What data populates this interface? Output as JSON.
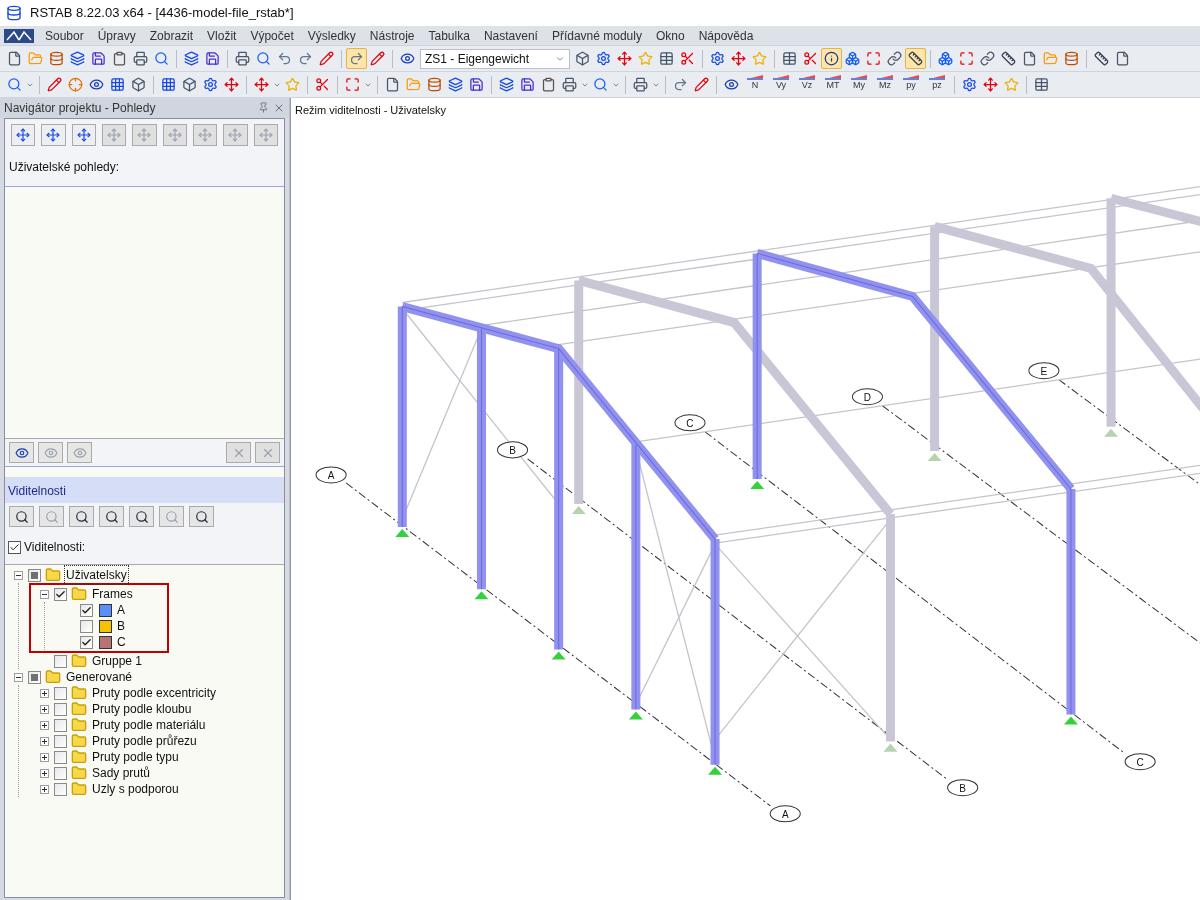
{
  "window": {
    "title": "RSTAB 8.22.03 x64 - [4436-model-file_rstab*]"
  },
  "menu": [
    "Soubor",
    "Úpravy",
    "Zobrazit",
    "Vložit",
    "Výpočet",
    "Výsledky",
    "Nástroje",
    "Tabulka",
    "Nastavení",
    "Přídavné moduly",
    "Okno",
    "Nápověda"
  ],
  "toolbars": [
    [
      [
        {
          "kind": "button",
          "selected": false
        },
        {
          "kind": "button",
          "selected": false
        },
        {
          "kind": "button",
          "selected": false
        },
        {
          "kind": "button",
          "selected": false
        },
        {
          "kind": "button",
          "selected": false
        },
        {
          "kind": "button",
          "selected": false
        },
        {
          "kind": "button",
          "selected": false
        },
        {
          "kind": "button",
          "selected": false
        }
      ],
      [
        {
          "kind": "button",
          "selected": false
        },
        {
          "kind": "button",
          "selected": false
        }
      ],
      [
        {
          "kind": "button",
          "selected": false
        },
        {
          "kind": "button",
          "selected": false
        },
        {
          "kind": "button",
          "selected": false
        },
        {
          "kind": "button",
          "selected": false
        },
        {
          "kind": "button",
          "selected": false
        }
      ],
      [
        {
          "kind": "button",
          "selected": true
        },
        {
          "kind": "button",
          "selected": false
        }
      ],
      [
        {
          "kind": "button",
          "selected": false
        },
        {
          "kind": "combo",
          "value": "ZS1 - Eigengewicht"
        },
        {
          "kind": "button",
          "selected": false
        },
        {
          "kind": "button",
          "selected": false
        },
        {
          "kind": "button",
          "selected": false
        },
        {
          "kind": "button",
          "selected": false
        },
        {
          "kind": "button",
          "selected": false
        },
        {
          "kind": "button",
          "selected": false
        }
      ],
      [
        {
          "kind": "button",
          "selected": false
        },
        {
          "kind": "button",
          "selected": false
        },
        {
          "kind": "button",
          "selected": false
        }
      ],
      [
        {
          "kind": "button",
          "selected": false
        },
        {
          "kind": "button",
          "selected": false
        },
        {
          "kind": "button",
          "selected": true
        },
        {
          "kind": "button",
          "selected": false
        },
        {
          "kind": "button",
          "selected": false
        },
        {
          "kind": "button",
          "selected": false
        },
        {
          "kind": "button",
          "selected": true
        }
      ],
      [
        {
          "kind": "button",
          "selected": false
        },
        {
          "kind": "button",
          "selected": false
        },
        {
          "kind": "button",
          "selected": false
        },
        {
          "kind": "button",
          "selected": false
        },
        {
          "kind": "button",
          "selected": false
        },
        {
          "kind": "button",
          "selected": false
        },
        {
          "kind": "button",
          "selected": false
        }
      ],
      [
        {
          "kind": "button",
          "selected": false
        },
        {
          "kind": "button",
          "selected": false
        }
      ]
    ],
    [
      [
        {
          "kind": "dropdown",
          "selected": false
        }
      ],
      [
        {
          "kind": "button",
          "selected": false
        },
        {
          "kind": "button",
          "selected": false
        },
        {
          "kind": "button",
          "selected": false
        },
        {
          "kind": "button",
          "selected": false
        },
        {
          "kind": "button",
          "selected": false
        }
      ],
      [
        {
          "kind": "button",
          "selected": false
        },
        {
          "kind": "button",
          "selected": false
        },
        {
          "kind": "button",
          "selected": false
        },
        {
          "kind": "button",
          "selected": false
        }
      ],
      [
        {
          "kind": "dropdown",
          "selected": false
        },
        {
          "kind": "button",
          "selected": false
        }
      ],
      [
        {
          "kind": "button",
          "selected": false
        }
      ],
      [
        {
          "kind": "dropdown",
          "selected": false
        }
      ],
      [
        {
          "kind": "button",
          "selected": false
        },
        {
          "kind": "button",
          "selected": false
        },
        {
          "kind": "button",
          "selected": false
        },
        {
          "kind": "button",
          "selected": false
        },
        {
          "kind": "button",
          "selected": false
        }
      ],
      [
        {
          "kind": "button",
          "selected": false
        },
        {
          "kind": "button",
          "selected": false
        },
        {
          "kind": "button",
          "selected": false
        },
        {
          "kind": "dropdown",
          "selected": false
        },
        {
          "kind": "dropdown",
          "selected": false
        }
      ],
      [
        {
          "kind": "dropdown",
          "selected": false
        }
      ],
      [
        {
          "kind": "button",
          "selected": false
        },
        {
          "kind": "button",
          "selected": false
        }
      ],
      [
        {
          "kind": "button",
          "selected": false
        },
        {
          "kind": "labeled",
          "label": "N",
          "selected": false
        },
        {
          "kind": "labeled",
          "label": "Vy",
          "selected": false
        },
        {
          "kind": "labeled",
          "label": "Vz",
          "selected": false
        },
        {
          "kind": "labeled",
          "label": "MT",
          "selected": false
        },
        {
          "kind": "labeled",
          "label": "My",
          "selected": false
        },
        {
          "kind": "labeled",
          "label": "Mz",
          "selected": false
        },
        {
          "kind": "labeled",
          "label": "py",
          "selected": false
        },
        {
          "kind": "labeled",
          "label": "pz",
          "selected": false
        }
      ],
      [
        {
          "kind": "button",
          "selected": false
        },
        {
          "kind": "button",
          "selected": false
        },
        {
          "kind": "button",
          "selected": false
        }
      ],
      [
        {
          "kind": "button",
          "selected": false
        }
      ]
    ]
  ],
  "navigator": {
    "title": "Navigátor projektu - Pohledy",
    "views_label": "Uživatelské pohledy:",
    "visibility": {
      "title": "Viditelnosti",
      "checkbox_label": "Viditelnosti:",
      "checked": true
    },
    "tree": [
      {
        "label": "Uživatelsky",
        "expanded": true,
        "checked": false,
        "indeterminate": true,
        "selected": true,
        "children": [
          {
            "label": "Frames",
            "expanded": true,
            "checked": true,
            "selected": false,
            "highlight": true,
            "children": [
              {
                "label": "A",
                "checked": true,
                "selected": false,
                "color": "#5b8ff9"
              },
              {
                "label": "B",
                "checked": false,
                "indeterminate": false,
                "selected": false,
                "color": "#f5c400"
              },
              {
                "label": "C",
                "checked": true,
                "selected": false,
                "color": "#b87474"
              }
            ]
          },
          {
            "label": "Gruppe 1",
            "checked": false,
            "indeterminate": false,
            "selected": false
          }
        ]
      },
      {
        "label": "Generované",
        "expanded": true,
        "checked": false,
        "indeterminate": true,
        "selected": false,
        "children": [
          {
            "label": "Pruty podle excentricity",
            "expanded": false,
            "checked": false,
            "indeterminate": false,
            "selected": false
          },
          {
            "label": "Pruty podle kloubu",
            "expanded": false,
            "checked": false,
            "indeterminate": false,
            "selected": false
          },
          {
            "label": "Pruty podle materiálu",
            "expanded": false,
            "checked": false,
            "indeterminate": false,
            "selected": false
          },
          {
            "label": "Pruty podle průřezu",
            "expanded": false,
            "checked": false,
            "indeterminate": false,
            "selected": false
          },
          {
            "label": "Pruty podle typu",
            "expanded": false,
            "checked": false,
            "indeterminate": false,
            "selected": false
          },
          {
            "label": "Sady prutů",
            "expanded": false,
            "checked": false,
            "indeterminate": false,
            "selected": false
          },
          {
            "label": "Uzly s podporou",
            "expanded": false,
            "checked": false,
            "indeterminate": false,
            "selected": false
          }
        ]
      }
    ]
  },
  "viewport": {
    "title": "Režim viditelnosti - Uživatelsky",
    "axis_labels": [
      "A",
      "B",
      "C",
      "D",
      "E",
      "A",
      "B",
      "C"
    ]
  }
}
